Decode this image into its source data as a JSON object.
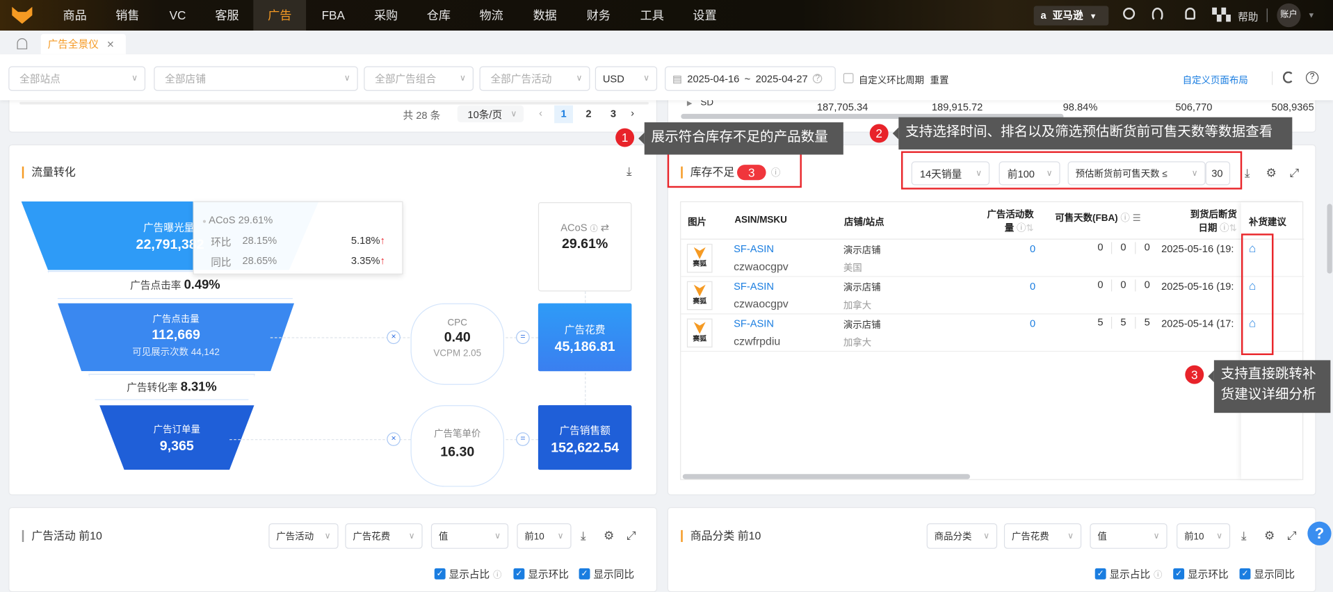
{
  "nav": {
    "items": [
      "商品",
      "销售",
      "VC",
      "客服",
      "广告",
      "FBA",
      "采购",
      "仓库",
      "物流",
      "数据",
      "财务",
      "工具",
      "设置"
    ],
    "active": "广告",
    "marketplace": "亚马逊",
    "help": "帮助",
    "account": "账户"
  },
  "tabs": {
    "active": "广告全景仪",
    "close": "✕"
  },
  "filters": {
    "site": "全部站点",
    "shop": "全部店铺",
    "ad_group": "全部广告组合",
    "campaign": "全部广告活动",
    "currency": "USD",
    "date_start": "2025-04-16",
    "date_sep": "~",
    "date_end": "2025-04-27",
    "custom_period": "自定义环比周期",
    "reset": "重置",
    "custom_layout": "自定义页面布局"
  },
  "top_left": {
    "total": "共 28 条",
    "page_size": "10条/页",
    "pages": [
      "1",
      "2",
      "3"
    ],
    "active_page": "1"
  },
  "top_right": {
    "row_label": "SD",
    "values": [
      "187,705.34",
      "189,915.72",
      "98.84%",
      "506,770",
      "508,936",
      "5"
    ]
  },
  "traffic": {
    "title": "流量转化",
    "impressions": {
      "label": "广告曝光量",
      "value": "22,791,382"
    },
    "tooltip": {
      "acos": "ACoS 29.61%",
      "mom_label": "环比",
      "mom_value": "28.15%",
      "mom_change": "5.18%",
      "yoy_label": "同比",
      "yoy_value": "28.65%",
      "yoy_change": "3.35%"
    },
    "ctr": {
      "label": "广告点击率",
      "value": "0.49%"
    },
    "clicks": {
      "label": "广告点击量",
      "value": "112,669",
      "sub": "可见展示次数 44,142"
    },
    "cvr": {
      "label": "广告转化率",
      "value": "8.31%"
    },
    "orders": {
      "label": "广告订单量",
      "value": "9,365"
    },
    "acos": {
      "label": "ACoS",
      "value": "29.61%"
    },
    "cpc": {
      "label": "CPC",
      "value": "0.40",
      "sub": "VCPM 2.05"
    },
    "spend": {
      "label": "广告花费",
      "value": "45,186.81"
    },
    "aov": {
      "label": "广告笔单价",
      "value": "16.30"
    },
    "sales": {
      "label": "广告销售额",
      "value": "152,622.54"
    },
    "times": "×",
    "equals": "="
  },
  "stock": {
    "title": "库存不足",
    "count": "3",
    "period": "14天销量",
    "rank": "前100",
    "filter_label": "预估断货前可售天数 ≤",
    "filter_value": "30",
    "headers": {
      "image": "图片",
      "asin": "ASIN/MSKU",
      "shop": "店铺/站点",
      "campaigns_1": "广告活动数",
      "campaigns_2": "量",
      "days": "可售天数(FBA)",
      "date_1": "到货后断货",
      "date_2": "日期",
      "suggest": "补货建议"
    },
    "rows": [
      {
        "logo": "赛狐",
        "asin": "SF-ASIN",
        "msku": "czwaocgpv",
        "shop": "演示店铺",
        "site": "美国",
        "campaigns": "0",
        "d1": "0",
        "d2": "0",
        "d3": "0",
        "date": "2025-05-16 (19:"
      },
      {
        "logo": "赛狐",
        "asin": "SF-ASIN",
        "msku": "czwaocgpv",
        "shop": "演示店铺",
        "site": "加拿大",
        "campaigns": "0",
        "d1": "0",
        "d2": "0",
        "d3": "0",
        "date": "2025-05-16 (19:"
      },
      {
        "logo": "赛狐",
        "asin": "SF-ASIN",
        "msku": "czwfrpdiu",
        "shop": "演示店铺",
        "site": "加拿大",
        "campaigns": "0",
        "d1": "5",
        "d2": "5",
        "d3": "5",
        "date": "2025-05-14 (17:"
      }
    ]
  },
  "annotations": [
    {
      "n": "1",
      "text": "展示符合库存不足的产品数量"
    },
    {
      "n": "2",
      "text": "支持选择时间、排名以及筛选预估断货前可售天数等数据查看"
    },
    {
      "n": "3",
      "line1": "支持直接跳转补",
      "line2": "货建议详细分析"
    }
  ],
  "campaign_top": {
    "title": "广告活动 前10",
    "dim": "广告活动",
    "metric": "广告花费",
    "mode": "值",
    "top": "前10",
    "show_share": "显示占比",
    "show_mom": "显示环比",
    "show_yoy": "显示同比"
  },
  "category_top": {
    "title": "商品分类 前10",
    "dim": "商品分类",
    "metric": "广告花费",
    "mode": "值",
    "top": "前10",
    "show_share": "显示占比",
    "show_mom": "显示环比",
    "show_yoy": "显示同比"
  },
  "float_help": "?"
}
